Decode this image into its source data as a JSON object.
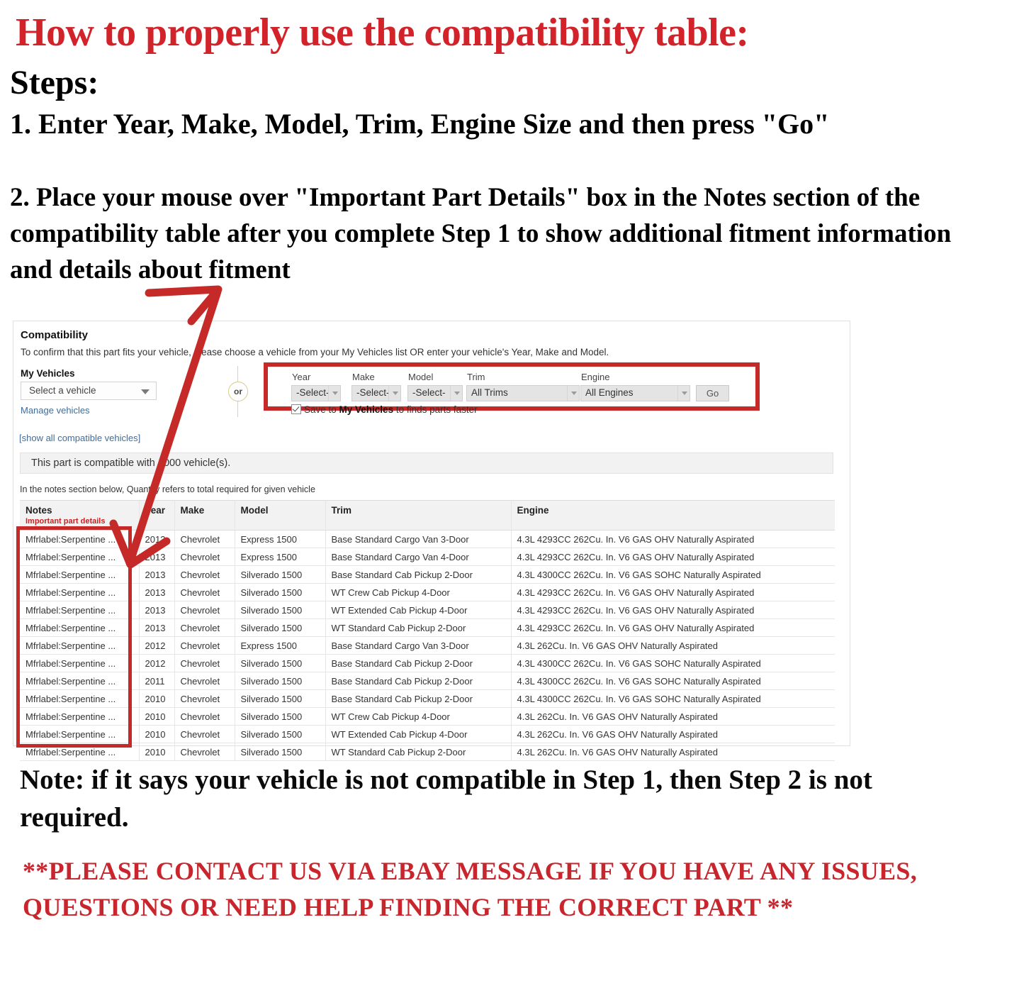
{
  "instructions": {
    "title": "How to properly use the compatibility table:",
    "steps_label": "Steps:",
    "step_one": "1. Enter Year, Make, Model, Trim, Engine Size and then press \"Go\"",
    "step_two": "2. Place your mouse over \"Important Part Details\" box in the Notes section of the compatibility table after you complete Step 1 to show additional fitment information and details about fitment",
    "note": "Note: if it says your vehicle is not compatible in Step 1, then Step 2 is not required.",
    "contact": "**PLEASE CONTACT US VIA EBAY MESSAGE IF YOU HAVE ANY ISSUES, QUESTIONS OR NEED HELP FINDING THE CORRECT PART **"
  },
  "colors": {
    "red_accent": "#d3232a",
    "highlight_box": "#c62a28",
    "link_blue": "#3f6d99",
    "notes_sub_red": "#cc1f1f"
  },
  "compatibility": {
    "title": "Compatibility",
    "subtitle": "To confirm that this part fits your vehicle, please choose a vehicle from your My Vehicles list OR enter your vehicle's Year, Make and Model.",
    "my_vehicles_label": "My Vehicles",
    "vehicle_select_value": "Select a vehicle",
    "manage_vehicles_link": "Manage vehicles",
    "show_all_link": "[show all compatible vehicles]",
    "or_label": "or",
    "count_text": "This part is compatible with 1000 vehicle(s).",
    "qty_note": "In the notes section below, Quantity refers to total required for given vehicle",
    "save_prefix": "Save to ",
    "save_bold": "My Vehicles",
    "save_suffix": " to finds parts faster",
    "go_label": "Go",
    "finder": [
      {
        "label": "Year",
        "value": "-Select-"
      },
      {
        "label": "Make",
        "value": "-Select-"
      },
      {
        "label": "Model",
        "value": "-Select-"
      },
      {
        "label": "Trim",
        "value": "All Trims"
      },
      {
        "label": "Engine",
        "value": "All Engines"
      }
    ]
  },
  "table": {
    "headers": {
      "notes": "Notes",
      "notes_sub": "Important part details",
      "year": "Year",
      "make": "Make",
      "model": "Model",
      "trim": "Trim",
      "engine": "Engine"
    },
    "rows": [
      {
        "notes": "Mfrlabel:Serpentine ...",
        "year": "2013",
        "make": "Chevrolet",
        "model": "Express 1500",
        "trim": "Base Standard Cargo Van 3-Door",
        "engine": "4.3L 4293CC 262Cu. In. V6 GAS OHV Naturally Aspirated"
      },
      {
        "notes": "Mfrlabel:Serpentine ...",
        "year": "2013",
        "make": "Chevrolet",
        "model": "Express 1500",
        "trim": "Base Standard Cargo Van 4-Door",
        "engine": "4.3L 4293CC 262Cu. In. V6 GAS OHV Naturally Aspirated"
      },
      {
        "notes": "Mfrlabel:Serpentine ...",
        "year": "2013",
        "make": "Chevrolet",
        "model": "Silverado 1500",
        "trim": "Base Standard Cab Pickup 2-Door",
        "engine": "4.3L 4300CC 262Cu. In. V6 GAS SOHC Naturally Aspirated"
      },
      {
        "notes": "Mfrlabel:Serpentine ...",
        "year": "2013",
        "make": "Chevrolet",
        "model": "Silverado 1500",
        "trim": "WT Crew Cab Pickup 4-Door",
        "engine": "4.3L 4293CC 262Cu. In. V6 GAS OHV Naturally Aspirated"
      },
      {
        "notes": "Mfrlabel:Serpentine ...",
        "year": "2013",
        "make": "Chevrolet",
        "model": "Silverado 1500",
        "trim": "WT Extended Cab Pickup 4-Door",
        "engine": "4.3L 4293CC 262Cu. In. V6 GAS OHV Naturally Aspirated"
      },
      {
        "notes": "Mfrlabel:Serpentine ...",
        "year": "2013",
        "make": "Chevrolet",
        "model": "Silverado 1500",
        "trim": "WT Standard Cab Pickup 2-Door",
        "engine": "4.3L 4293CC 262Cu. In. V6 GAS OHV Naturally Aspirated"
      },
      {
        "notes": "Mfrlabel:Serpentine ...",
        "year": "2012",
        "make": "Chevrolet",
        "model": "Express 1500",
        "trim": "Base Standard Cargo Van 3-Door",
        "engine": "4.3L 262Cu. In. V6 GAS OHV Naturally Aspirated"
      },
      {
        "notes": "Mfrlabel:Serpentine ...",
        "year": "2012",
        "make": "Chevrolet",
        "model": "Silverado 1500",
        "trim": "Base Standard Cab Pickup 2-Door",
        "engine": "4.3L 4300CC 262Cu. In. V6 GAS SOHC Naturally Aspirated"
      },
      {
        "notes": "Mfrlabel:Serpentine ...",
        "year": "2011",
        "make": "Chevrolet",
        "model": "Silverado 1500",
        "trim": "Base Standard Cab Pickup 2-Door",
        "engine": "4.3L 4300CC 262Cu. In. V6 GAS SOHC Naturally Aspirated"
      },
      {
        "notes": "Mfrlabel:Serpentine ...",
        "year": "2010",
        "make": "Chevrolet",
        "model": "Silverado 1500",
        "trim": "Base Standard Cab Pickup 2-Door",
        "engine": "4.3L 4300CC 262Cu. In. V6 GAS SOHC Naturally Aspirated"
      },
      {
        "notes": "Mfrlabel:Serpentine ...",
        "year": "2010",
        "make": "Chevrolet",
        "model": "Silverado 1500",
        "trim": "WT Crew Cab Pickup 4-Door",
        "engine": "4.3L 262Cu. In. V6 GAS OHV Naturally Aspirated"
      },
      {
        "notes": "Mfrlabel:Serpentine ...",
        "year": "2010",
        "make": "Chevrolet",
        "model": "Silverado 1500",
        "trim": "WT Extended Cab Pickup 4-Door",
        "engine": "4.3L 262Cu. In. V6 GAS OHV Naturally Aspirated"
      },
      {
        "notes": "Mfrlabel:Serpentine ...",
        "year": "2010",
        "make": "Chevrolet",
        "model": "Silverado 1500",
        "trim": "WT Standard Cab Pickup 2-Door",
        "engine": "4.3L 262Cu. In. V6 GAS OHV Naturally Aspirated"
      }
    ]
  }
}
